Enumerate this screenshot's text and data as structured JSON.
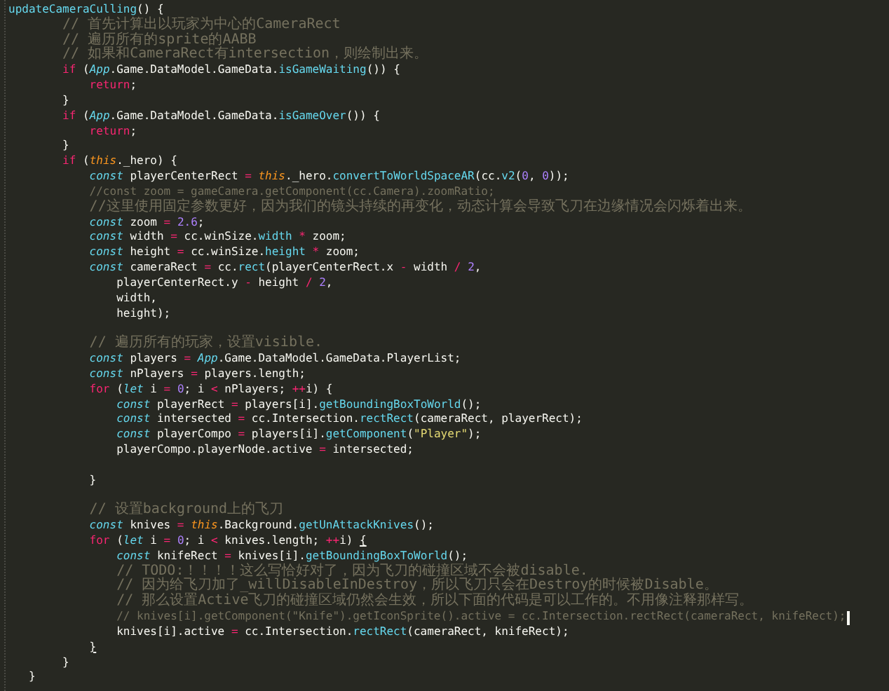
{
  "editor": {
    "lines": [
      {
        "cursor": false,
        "tokens": [
          {
            "kind": "call",
            "text": "updateCameraCulling"
          },
          {
            "kind": "plain",
            "text": "() {"
          }
        ]
      },
      {
        "cursor": false,
        "tokens": [
          {
            "kind": "comment_zh",
            "text": "        // 首先计算出以玩家为中心的CameraRect"
          }
        ]
      },
      {
        "cursor": false,
        "tokens": [
          {
            "kind": "comment_zh",
            "text": "        // 遍历所有的sprite的AABB"
          }
        ]
      },
      {
        "cursor": false,
        "tokens": [
          {
            "kind": "comment_zh",
            "text": "        // 如果和CameraRect有intersection，则绘制出来。"
          }
        ]
      },
      {
        "cursor": false,
        "tokens": [
          {
            "kind": "keyword",
            "text": "        if"
          },
          {
            "kind": "plain",
            "text": " ("
          },
          {
            "kind": "class",
            "text": "App"
          },
          {
            "kind": "plain",
            "text": ".Game.DataModel.GameData."
          },
          {
            "kind": "call",
            "text": "isGameWaiting"
          },
          {
            "kind": "plain",
            "text": "()) {"
          }
        ]
      },
      {
        "cursor": false,
        "tokens": [
          {
            "kind": "keyword",
            "text": "            return"
          },
          {
            "kind": "plain",
            "text": ";"
          }
        ]
      },
      {
        "cursor": false,
        "tokens": [
          {
            "kind": "plain",
            "text": "        }"
          }
        ]
      },
      {
        "cursor": false,
        "tokens": [
          {
            "kind": "keyword",
            "text": "        if"
          },
          {
            "kind": "plain",
            "text": " ("
          },
          {
            "kind": "class",
            "text": "App"
          },
          {
            "kind": "plain",
            "text": ".Game.DataModel.GameData."
          },
          {
            "kind": "call",
            "text": "isGameOver"
          },
          {
            "kind": "plain",
            "text": "()) {"
          }
        ]
      },
      {
        "cursor": false,
        "tokens": [
          {
            "kind": "keyword",
            "text": "            return"
          },
          {
            "kind": "plain",
            "text": ";"
          }
        ]
      },
      {
        "cursor": false,
        "tokens": [
          {
            "kind": "plain",
            "text": "        }"
          }
        ]
      },
      {
        "cursor": false,
        "tokens": [
          {
            "kind": "keyword",
            "text": "        if"
          },
          {
            "kind": "plain",
            "text": " ("
          },
          {
            "kind": "variable",
            "text": "this"
          },
          {
            "kind": "plain",
            "text": "._hero) {"
          }
        ]
      },
      {
        "cursor": false,
        "tokens": [
          {
            "kind": "storage",
            "text": "            const"
          },
          {
            "kind": "plain",
            "text": " playerCenterRect"
          },
          {
            "kind": "operator",
            "text": " = "
          },
          {
            "kind": "variable",
            "text": "this"
          },
          {
            "kind": "plain",
            "text": "._hero."
          },
          {
            "kind": "call",
            "text": "convertToWorldSpaceAR"
          },
          {
            "kind": "plain",
            "text": "(cc."
          },
          {
            "kind": "call",
            "text": "v2"
          },
          {
            "kind": "plain",
            "text": "("
          },
          {
            "kind": "number",
            "text": "0"
          },
          {
            "kind": "plain",
            "text": ", "
          },
          {
            "kind": "number",
            "text": "0"
          },
          {
            "kind": "plain",
            "text": "));"
          }
        ]
      },
      {
        "cursor": false,
        "tokens": [
          {
            "kind": "comment",
            "text": "            //const zoom = gameCamera.getComponent(cc.Camera).zoomRatio;"
          }
        ]
      },
      {
        "cursor": false,
        "tokens": [
          {
            "kind": "comment_zh",
            "text": "            //这里使用固定参数更好，因为我们的镜头持续的再变化，动态计算会导致飞刀在边缘情况会闪烁着出来。"
          }
        ]
      },
      {
        "cursor": false,
        "tokens": [
          {
            "kind": "storage",
            "text": "            const"
          },
          {
            "kind": "plain",
            "text": " zoom"
          },
          {
            "kind": "operator",
            "text": " = "
          },
          {
            "kind": "number",
            "text": "2.6"
          },
          {
            "kind": "plain",
            "text": ";"
          }
        ]
      },
      {
        "cursor": false,
        "tokens": [
          {
            "kind": "storage",
            "text": "            const"
          },
          {
            "kind": "plain",
            "text": " width"
          },
          {
            "kind": "operator",
            "text": " = "
          },
          {
            "kind": "plain",
            "text": "cc.winSize."
          },
          {
            "kind": "call",
            "text": "width"
          },
          {
            "kind": "operator",
            "text": " * "
          },
          {
            "kind": "plain",
            "text": "zoom;"
          }
        ]
      },
      {
        "cursor": false,
        "tokens": [
          {
            "kind": "storage",
            "text": "            const"
          },
          {
            "kind": "plain",
            "text": " height"
          },
          {
            "kind": "operator",
            "text": " = "
          },
          {
            "kind": "plain",
            "text": "cc.winSize."
          },
          {
            "kind": "call",
            "text": "height"
          },
          {
            "kind": "operator",
            "text": " * "
          },
          {
            "kind": "plain",
            "text": "zoom;"
          }
        ]
      },
      {
        "cursor": false,
        "tokens": [
          {
            "kind": "storage",
            "text": "            const"
          },
          {
            "kind": "plain",
            "text": " cameraRect"
          },
          {
            "kind": "operator",
            "text": " = "
          },
          {
            "kind": "plain",
            "text": "cc."
          },
          {
            "kind": "call",
            "text": "rect"
          },
          {
            "kind": "plain",
            "text": "(playerCenterRect.x"
          },
          {
            "kind": "operator",
            "text": " - "
          },
          {
            "kind": "plain",
            "text": "width"
          },
          {
            "kind": "operator",
            "text": " / "
          },
          {
            "kind": "number",
            "text": "2"
          },
          {
            "kind": "plain",
            "text": ","
          }
        ]
      },
      {
        "cursor": false,
        "tokens": [
          {
            "kind": "plain",
            "text": "                playerCenterRect.y"
          },
          {
            "kind": "operator",
            "text": " - "
          },
          {
            "kind": "plain",
            "text": "height"
          },
          {
            "kind": "operator",
            "text": " / "
          },
          {
            "kind": "number",
            "text": "2"
          },
          {
            "kind": "plain",
            "text": ","
          }
        ]
      },
      {
        "cursor": false,
        "tokens": [
          {
            "kind": "plain",
            "text": "                width,"
          }
        ]
      },
      {
        "cursor": false,
        "tokens": [
          {
            "kind": "plain",
            "text": "                height);"
          }
        ]
      },
      {
        "cursor": false
      },
      {
        "cursor": false,
        "tokens": [
          {
            "kind": "comment_zh",
            "text": "            // 遍历所有的玩家，设置visible."
          }
        ]
      },
      {
        "cursor": false,
        "tokens": [
          {
            "kind": "storage",
            "text": "            const"
          },
          {
            "kind": "plain",
            "text": " players"
          },
          {
            "kind": "operator",
            "text": " = "
          },
          {
            "kind": "class",
            "text": "App"
          },
          {
            "kind": "plain",
            "text": ".Game.DataModel.GameData.PlayerList;"
          }
        ]
      },
      {
        "cursor": false,
        "tokens": [
          {
            "kind": "storage",
            "text": "            const"
          },
          {
            "kind": "plain",
            "text": " nPlayers"
          },
          {
            "kind": "operator",
            "text": " = "
          },
          {
            "kind": "plain",
            "text": "players.length;"
          }
        ]
      },
      {
        "cursor": false,
        "tokens": [
          {
            "kind": "keyword",
            "text": "            for"
          },
          {
            "kind": "plain",
            "text": " ("
          },
          {
            "kind": "storage",
            "text": "let"
          },
          {
            "kind": "plain",
            "text": " i"
          },
          {
            "kind": "operator",
            "text": " = "
          },
          {
            "kind": "number",
            "text": "0"
          },
          {
            "kind": "plain",
            "text": "; i"
          },
          {
            "kind": "operator",
            "text": " < "
          },
          {
            "kind": "plain",
            "text": "nPlayers; "
          },
          {
            "kind": "operator",
            "text": "++"
          },
          {
            "kind": "plain",
            "text": "i) {"
          }
        ]
      },
      {
        "cursor": false,
        "tokens": [
          {
            "kind": "storage",
            "text": "                const"
          },
          {
            "kind": "plain",
            "text": " playerRect"
          },
          {
            "kind": "operator",
            "text": " = "
          },
          {
            "kind": "plain",
            "text": "players[i]."
          },
          {
            "kind": "call",
            "text": "getBoundingBoxToWorld"
          },
          {
            "kind": "plain",
            "text": "();"
          }
        ]
      },
      {
        "cursor": false,
        "tokens": [
          {
            "kind": "storage",
            "text": "                const"
          },
          {
            "kind": "plain",
            "text": " intersected"
          },
          {
            "kind": "operator",
            "text": " = "
          },
          {
            "kind": "plain",
            "text": "cc.Intersection."
          },
          {
            "kind": "call",
            "text": "rectRect"
          },
          {
            "kind": "plain",
            "text": "(cameraRect, playerRect);"
          }
        ]
      },
      {
        "cursor": false,
        "tokens": [
          {
            "kind": "storage",
            "text": "                const"
          },
          {
            "kind": "plain",
            "text": " playerCompo"
          },
          {
            "kind": "operator",
            "text": " = "
          },
          {
            "kind": "plain",
            "text": "players[i]."
          },
          {
            "kind": "call",
            "text": "getComponent"
          },
          {
            "kind": "plain",
            "text": "("
          },
          {
            "kind": "string",
            "text": "\"Player\""
          },
          {
            "kind": "plain",
            "text": ");"
          }
        ]
      },
      {
        "cursor": false,
        "tokens": [
          {
            "kind": "plain",
            "text": "                playerCompo.playerNode.active"
          },
          {
            "kind": "operator",
            "text": " = "
          },
          {
            "kind": "plain",
            "text": "intersected;"
          }
        ]
      },
      {
        "cursor": false
      },
      {
        "cursor": false,
        "tokens": [
          {
            "kind": "plain",
            "text": "            }"
          }
        ]
      },
      {
        "cursor": false
      },
      {
        "cursor": false,
        "tokens": [
          {
            "kind": "comment_zh",
            "text": "            // 设置background上的飞刀"
          }
        ]
      },
      {
        "cursor": false,
        "tokens": [
          {
            "kind": "storage",
            "text": "            const"
          },
          {
            "kind": "plain",
            "text": " knives"
          },
          {
            "kind": "operator",
            "text": " = "
          },
          {
            "kind": "variable",
            "text": "this"
          },
          {
            "kind": "plain",
            "text": ".Background."
          },
          {
            "kind": "call",
            "text": "getUnAttackKnives"
          },
          {
            "kind": "plain",
            "text": "();"
          }
        ]
      },
      {
        "cursor": false,
        "tokens": [
          {
            "kind": "keyword",
            "text": "            for"
          },
          {
            "kind": "plain",
            "text": " ("
          },
          {
            "kind": "storage",
            "text": "let"
          },
          {
            "kind": "plain",
            "text": " i"
          },
          {
            "kind": "operator",
            "text": " = "
          },
          {
            "kind": "number",
            "text": "0"
          },
          {
            "kind": "plain",
            "text": "; i"
          },
          {
            "kind": "operator",
            "text": " < "
          },
          {
            "kind": "plain",
            "text": "knives.length; "
          },
          {
            "kind": "operator",
            "text": "++"
          },
          {
            "kind": "plain",
            "text": "i) "
          },
          {
            "kind": "bracket_match",
            "text": "{"
          }
        ]
      },
      {
        "cursor": false,
        "tokens": [
          {
            "kind": "storage",
            "text": "                const"
          },
          {
            "kind": "plain",
            "text": " knifeRect"
          },
          {
            "kind": "operator",
            "text": " = "
          },
          {
            "kind": "plain",
            "text": "knives[i]."
          },
          {
            "kind": "call",
            "text": "getBoundingBoxToWorld"
          },
          {
            "kind": "plain",
            "text": "();"
          }
        ]
      },
      {
        "cursor": false,
        "tokens": [
          {
            "kind": "comment_zh",
            "text": "                // TODO:！！！！这么写恰好对了，因为飞刀的碰撞区域不会被disable."
          }
        ]
      },
      {
        "cursor": false,
        "tokens": [
          {
            "kind": "comment_zh",
            "text": "                // 因为给飞刀加了_willDisableInDestroy，所以飞刀只会在Destroy的时候被Disable。"
          }
        ]
      },
      {
        "cursor": false,
        "tokens": [
          {
            "kind": "comment_zh",
            "text": "                // 那么设置Active飞刀的碰撞区域仍然会生效，所以下面的代码是可以工作的。不用像注释那样写。"
          }
        ]
      },
      {
        "cursor": true,
        "tokens": [
          {
            "kind": "comment",
            "text": "                // knives[i].getComponent(\"Knife\").getIconSprite().active = cc.Intersection.rectRect(cameraRect, knifeRect);"
          }
        ]
      },
      {
        "cursor": false,
        "tokens": [
          {
            "kind": "plain",
            "text": "                knives[i].active"
          },
          {
            "kind": "operator",
            "text": " = "
          },
          {
            "kind": "plain",
            "text": "cc.Intersection."
          },
          {
            "kind": "call",
            "text": "rectRect"
          },
          {
            "kind": "plain",
            "text": "(cameraRect, knifeRect);"
          }
        ]
      },
      {
        "cursor": false,
        "tokens": [
          {
            "kind": "bracket_match",
            "text": "            }"
          }
        ]
      },
      {
        "cursor": false,
        "tokens": [
          {
            "kind": "plain",
            "text": "        }"
          }
        ]
      },
      {
        "cursor": false,
        "tokens": [
          {
            "kind": "plain",
            "text": "   }"
          }
        ]
      }
    ]
  }
}
